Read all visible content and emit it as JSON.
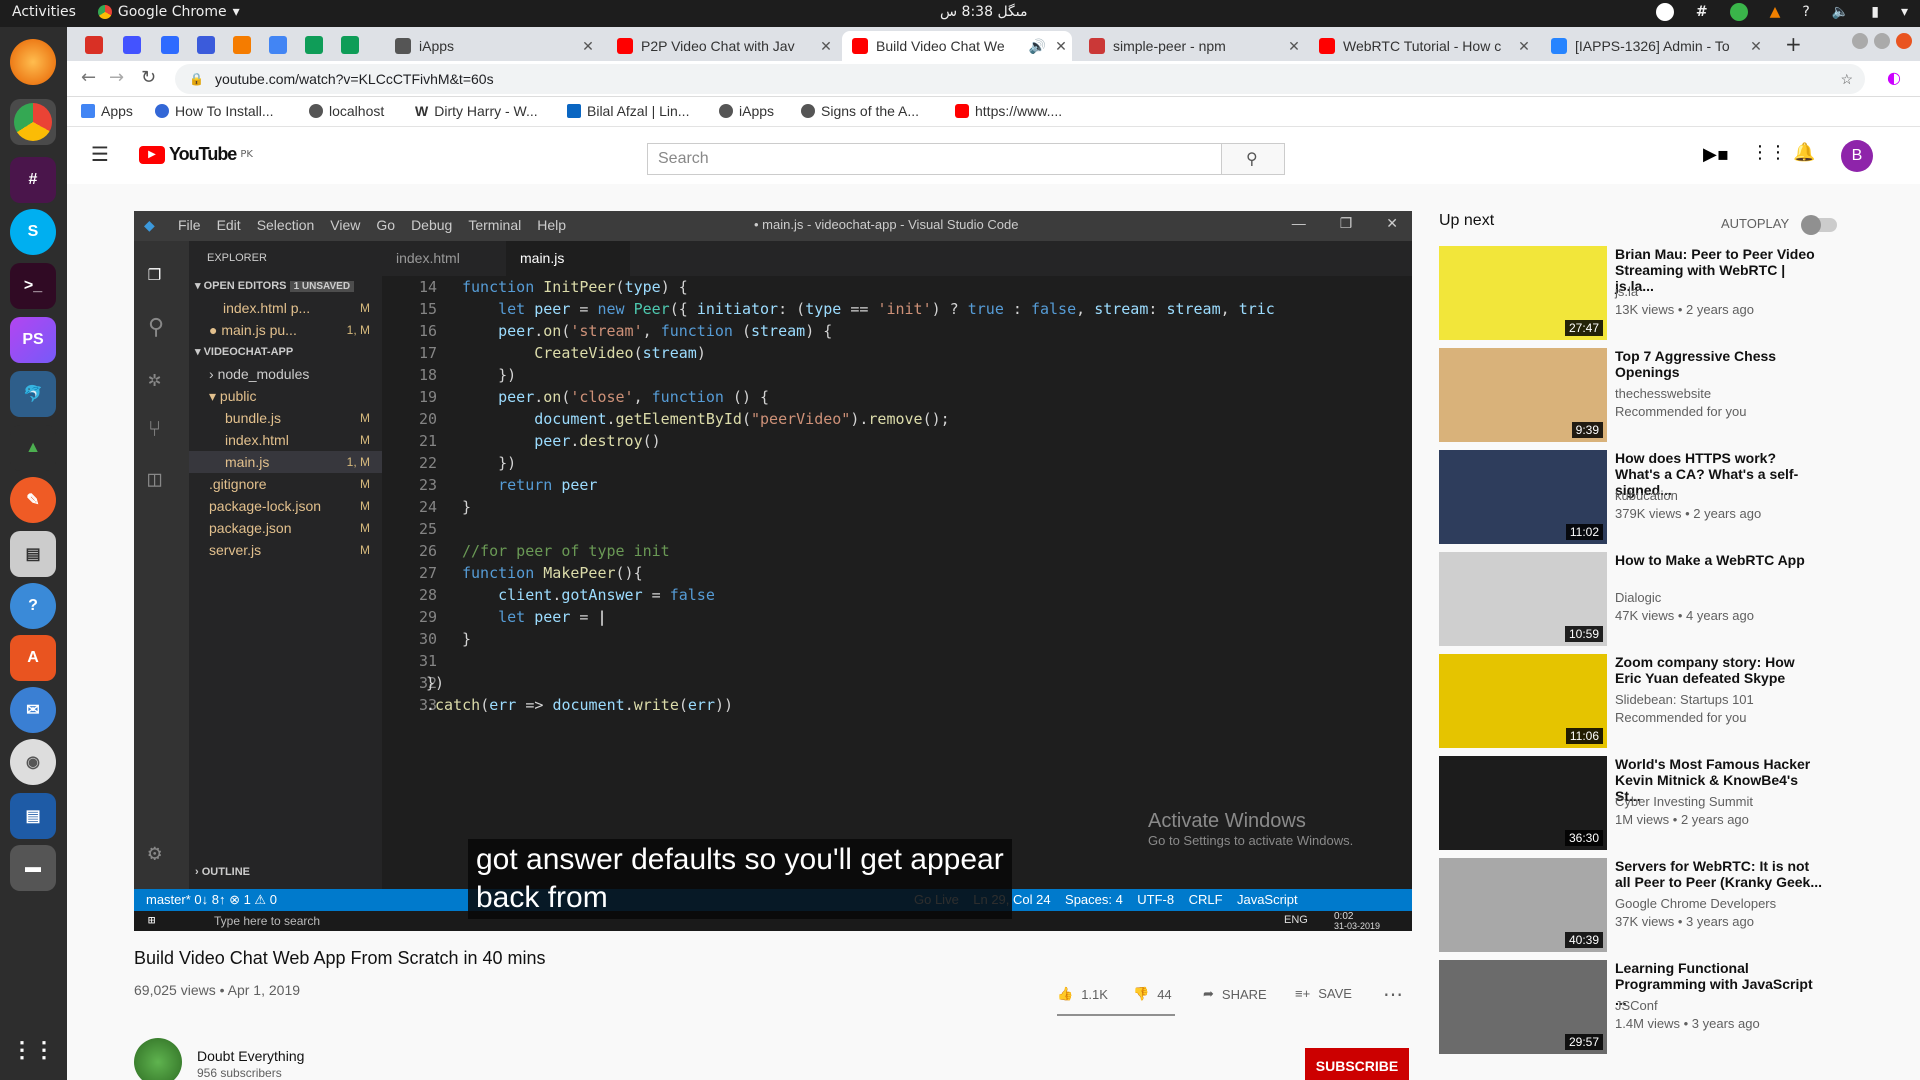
{
  "topbar": {
    "activities": "Activities",
    "app": "Google Chrome",
    "clock": "مںگل 8:38 س"
  },
  "chrome": {
    "tabs": [
      {
        "title": "iApps"
      },
      {
        "title": "P2P Video Chat with Jav"
      },
      {
        "title": "Build Video Chat We"
      },
      {
        "title": "simple-peer - npm"
      },
      {
        "title": "WebRTC Tutorial - How c"
      },
      {
        "title": "[IAPPS-1326] Admin - To"
      }
    ],
    "url": "youtube.com/watch?v=KLCcCTFivhM&t=60s",
    "bookmarks": [
      "Apps",
      "How To Install...",
      "localhost",
      "Dirty Harry - W...",
      "Bilal Afzal | Lin...",
      "iApps",
      "Signs of the A...",
      "https://www...."
    ],
    "profile_initial": "B"
  },
  "youtube": {
    "logo": "YouTube",
    "region": "PK",
    "search_placeholder": "Search",
    "avatar": "B",
    "video": {
      "title": "Build Video Chat Web App From Scratch in 40 mins",
      "meta": "69,025 views • Apr 1, 2019",
      "likes": "1.1K",
      "dislikes": "44",
      "share": "SHARE",
      "save": "SAVE",
      "channel": "Doubt Everything",
      "subscribers": "956 subscribers",
      "subscribe": "SUBSCRIBE",
      "caption_line1": "got answer defaults so you'll get appear",
      "caption_line2": "back from"
    },
    "vscode": {
      "menu": [
        "File",
        "Edit",
        "Selection",
        "View",
        "Go",
        "Debug",
        "Terminal",
        "Help"
      ],
      "window_title": "• main.js - videochat-app - Visual Studio Code",
      "explorer": "EXPLORER",
      "open_editors": "OPEN EDITORS",
      "unsaved": "1 UNSAVED",
      "open_files": [
        "index.html  p...",
        "main.js  pu..."
      ],
      "project": "VIDEOCHAT-APP",
      "tree": [
        "node_modules",
        "public",
        "bundle.js",
        "index.html",
        "main.js",
        ".gitignore",
        "package-lock.json",
        "package.json",
        "server.js"
      ],
      "outline": "OUTLINE",
      "tabs": [
        "index.html",
        "main.js"
      ],
      "line_numbers": [
        "14",
        "15",
        "16",
        "17",
        "18",
        "19",
        "20",
        "21",
        "22",
        "23",
        "24",
        "25",
        "26",
        "27",
        "28",
        "29",
        "30",
        "31",
        "32",
        "33"
      ],
      "status_left": "master*   0↓ 8↑   ⊗ 1 ⚠ 0",
      "status_right": "Go Live    Ln 29, Col 24    Spaces: 4    UTF-8    CRLF    JavaScript",
      "watermark1": "Activate Windows",
      "watermark2": "Go to Settings to activate Windows.",
      "taskbar_search": "Type here to search",
      "taskbar_time": "0:02",
      "taskbar_date": "31-03-2019",
      "taskbar_lang": "ENG"
    },
    "upnext": {
      "heading": "Up next",
      "autoplay": "AUTOPLAY",
      "items": [
        {
          "title": "Brian Mau: Peer to Peer Video Streaming with WebRTC | js.la...",
          "channel": "js.la",
          "views": "13K views • 2 years ago",
          "duration": "27:47",
          "thumb": "#f2e63a"
        },
        {
          "title": "Top 7 Aggressive Chess Openings",
          "channel": "thechesswebsite",
          "views": "Recommended for you",
          "duration": "9:39",
          "thumb": "#d9b27a"
        },
        {
          "title": "How does HTTPS work? What's a CA? What's a self-signed...",
          "channel": "kubucation",
          "views": "379K views • 2 years ago",
          "duration": "11:02",
          "thumb": "#2e3d5c"
        },
        {
          "title": "How to Make a WebRTC App",
          "channel": "Dialogic",
          "views": "47K views • 4 years ago",
          "duration": "10:59",
          "thumb": "#cfcfcf"
        },
        {
          "title": "Zoom company story: How Eric Yuan defeated Skype",
          "channel": "Slidebean: Startups 101",
          "views": "Recommended for you",
          "duration": "11:06",
          "thumb": "#e5c400"
        },
        {
          "title": "World's Most Famous Hacker Kevin Mitnick & KnowBe4's St...",
          "channel": "Cyber Investing Summit",
          "views": "1M views • 2 years ago",
          "duration": "36:30",
          "thumb": "#1c1c1c"
        },
        {
          "title": "Servers for WebRTC: It is not all Peer to Peer (Kranky Geek...",
          "channel": "Google Chrome Developers",
          "views": "37K views • 3 years ago",
          "duration": "40:39",
          "thumb": "#a8a8a8"
        },
        {
          "title": "Learning Functional Programming with JavaScript ...",
          "channel": "JSConf",
          "views": "1.4M views • 3 years ago",
          "duration": "29:57",
          "thumb": "#6b6b6b"
        }
      ]
    }
  }
}
